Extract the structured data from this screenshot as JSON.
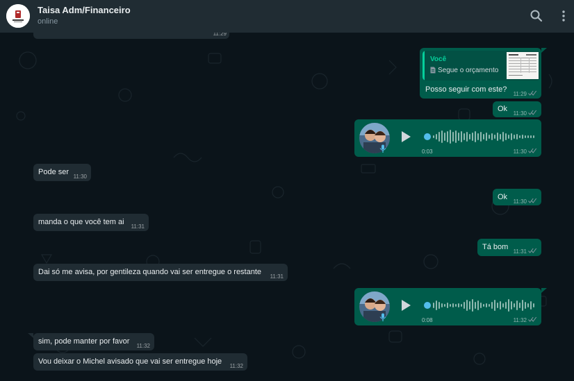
{
  "header": {
    "contact_name": "Taisa Adm/Financeiro",
    "status": "online",
    "search_icon": "search-icon",
    "menu_icon": "kebab-menu-icon"
  },
  "colors": {
    "background": "#0b141a",
    "header": "#202c33",
    "incoming_bubble": "#202c33",
    "outgoing_bubble": "#005c4b",
    "accent": "#06cf9c",
    "tick": "#8696a0"
  },
  "messages": [
    {
      "direction": "in",
      "text": "",
      "time": "11:29"
    },
    {
      "direction": "out",
      "type": "reply",
      "quoted_author": "Você",
      "quoted_text": "Segue o orçamento",
      "text": "Posso seguir com este?",
      "time": "11:29"
    },
    {
      "direction": "out",
      "text": "Ok",
      "time": "11:30"
    },
    {
      "direction": "out",
      "type": "voice",
      "duration": "0:03",
      "time": "11:30"
    },
    {
      "direction": "in",
      "text": "Pode ser",
      "time": "11:30"
    },
    {
      "direction": "out",
      "text": "Ok",
      "time": "11:30"
    },
    {
      "direction": "in",
      "text": "manda o que você tem ai",
      "time": "11:31"
    },
    {
      "direction": "out",
      "text": "Tá bom",
      "time": "11:31"
    },
    {
      "direction": "in",
      "text": "Dai só me avisa, por gentileza quando vai ser entregue o restante",
      "time": "11:31"
    },
    {
      "direction": "out",
      "type": "voice",
      "duration": "0:08",
      "time": "11:32"
    },
    {
      "direction": "in",
      "text": "sim, pode manter por favor",
      "time": "11:32"
    },
    {
      "direction": "in",
      "text": "Vou deixar o Michel avisado que vai ser entregue hoje",
      "time": "11:32"
    }
  ],
  "voice_progress": [
    0.0,
    0.0
  ]
}
